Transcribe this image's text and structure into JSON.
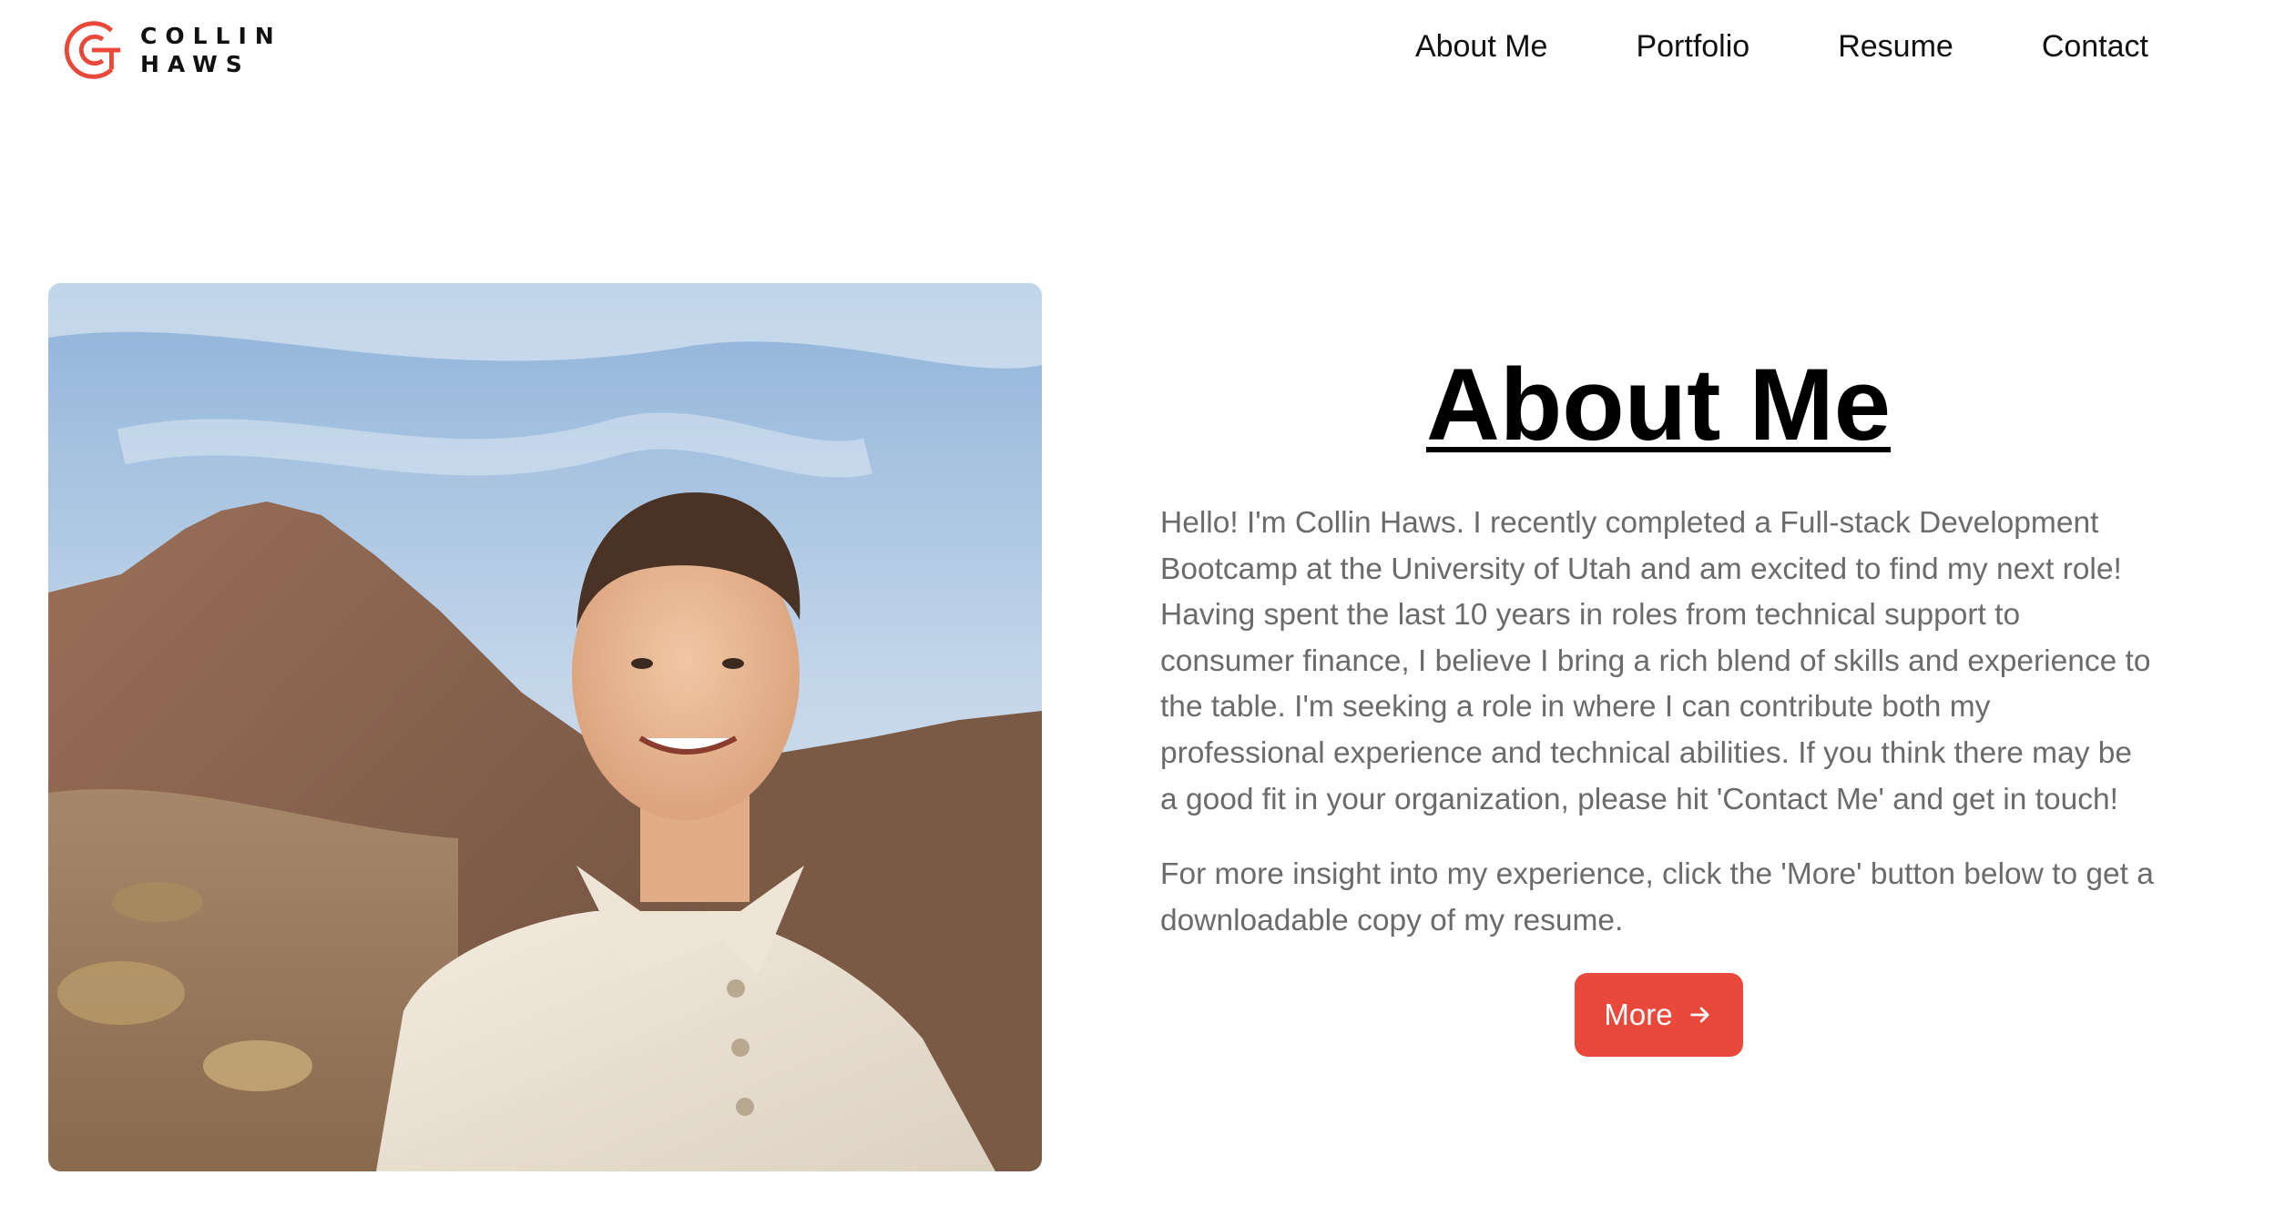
{
  "brand": {
    "name_line1": "COLLIN",
    "name_line2": "HAWS",
    "accent_color": "#e8493b"
  },
  "nav": {
    "items": [
      {
        "label": "About Me"
      },
      {
        "label": "Portfolio"
      },
      {
        "label": "Resume"
      },
      {
        "label": "Contact"
      }
    ]
  },
  "photo": {
    "subject": "portrait-photo"
  },
  "about": {
    "title": "About Me",
    "paragraph1": "Hello! I'm Collin Haws. I recently completed a Full-stack Development Bootcamp at the University of Utah and am excited to find my next role! Having spent the last 10 years in roles from technical support to consumer finance, I believe I bring a rich blend of skills and experience to the table. I'm seeking a role in where I can contribute both my professional experience and technical abilities. If you think there may be a good fit in your organization, please hit 'Contact Me' and get in touch!",
    "paragraph2": "For more insight into my experience, click the 'More' button below to get a downloadable copy of my resume.",
    "more_button": "More",
    "more_icon": "arrow-right-icon"
  }
}
